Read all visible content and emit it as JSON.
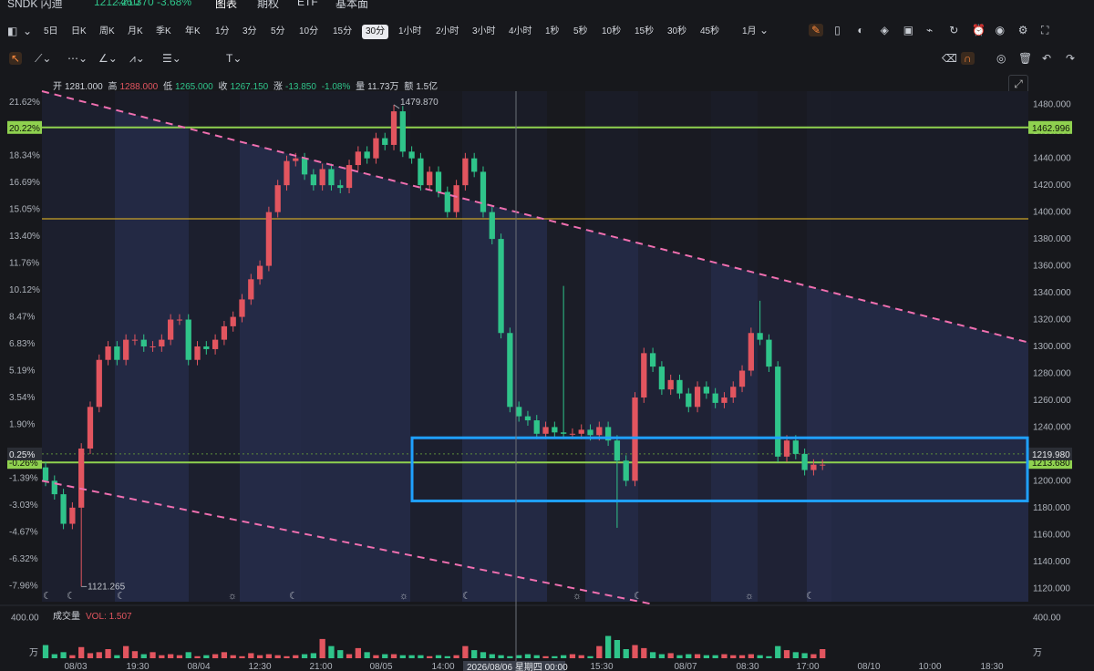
{
  "header": {
    "symbol": "SNDK 闪迪",
    "price": "1212.210",
    "change": "-46.370",
    "change_pct": "-3.68%",
    "tabs": [
      "图表",
      "期权",
      "ETF",
      "基本面"
    ]
  },
  "toolbar": {
    "periods": [
      "5日",
      "日K",
      "周K",
      "月K",
      "季K",
      "年K",
      "1分",
      "3分",
      "5分",
      "10分",
      "15分",
      "30分",
      "1小时",
      "2小时",
      "3小时",
      "4小时",
      "1秒",
      "5秒",
      "10秒",
      "15秒",
      "30秒",
      "45秒"
    ],
    "active_period": "30分",
    "range_label": "1月",
    "right_icons": [
      "pen-icon",
      "candle-icon",
      "compare-icon",
      "layers-icon",
      "indicator-icon",
      "chart-icon",
      "replay-icon",
      "alert-icon",
      "camera-icon",
      "settings-icon",
      "fullscreen-icon"
    ],
    "draw_tools": [
      "cursor-icon",
      "line-tool-icon",
      "fib-tool-icon",
      "brush-icon",
      "pattern-tool-icon",
      "measure-tool-icon",
      "text-tool-icon"
    ],
    "draw_right_icons": [
      "eraser-icon",
      "magnet-icon",
      "eye-icon",
      "trash-icon",
      "undo-icon",
      "redo-icon"
    ]
  },
  "ohlc": {
    "open_label": "开",
    "open": "1281.000",
    "high_label": "高",
    "high": "1288.000",
    "low_label": "低",
    "low": "1265.000",
    "close_label": "收",
    "close": "1267.150",
    "chg_label": "涨",
    "chg": "-13.850",
    "chg_pct": "-1.08%",
    "vol_label": "量",
    "vol": "11.73万",
    "amt_label": "额",
    "amt": "1.5亿"
  },
  "chart_data": {
    "type": "candlestick",
    "title": "",
    "ylim": [
      1110,
      1490
    ],
    "y_ticks": [
      1120,
      1140,
      1160,
      1180,
      1200,
      1220,
      1240,
      1260,
      1280,
      1300,
      1320,
      1340,
      1360,
      1380,
      1400,
      1420,
      1440,
      1460,
      1480
    ],
    "y_tick_labels": [
      "1120.000",
      "1140.000",
      "1160.000",
      "1180.000",
      "1200.000",
      "1220.000",
      "1240.000",
      "1260.000",
      "1280.000",
      "1300.000",
      "1320.000",
      "1340.000",
      "1360.000",
      "1380.000",
      "1400.000",
      "1420.000",
      "1440.000",
      "1460.000",
      "1480.000"
    ],
    "pct_ticks": [
      "21.62%",
      "18.34%",
      "16.69%",
      "15.05%",
      "13.40%",
      "11.76%",
      "10.12%",
      "8.47%",
      "6.83%",
      "5.19%",
      "3.54%",
      "1.90%",
      "0.25%",
      "-0.26%",
      "-1.39%",
      "-3.03%",
      "-4.67%",
      "-6.32%",
      "-7.96%"
    ],
    "pct_tick_values": [
      1482,
      1442,
      1422,
      1402,
      1382,
      1362,
      1342,
      1322,
      1302,
      1282,
      1262,
      1242,
      1222,
      1216,
      1202,
      1182,
      1162,
      1142,
      1122
    ],
    "x_tick_labels": [
      "08/03",
      "19:30",
      "08/04",
      "12:30",
      "21:00",
      "08/05",
      "14:00",
      "15:30",
      "08/07",
      "08:30",
      "17:00",
      "08/10",
      "10:00",
      "18:30"
    ],
    "crosshair_label": "2026/08/06 星期四 00:00",
    "price_levels": [
      {
        "value": 1462.996,
        "label": "1462.996",
        "pct": "20.22%",
        "color": "#8fd14f"
      },
      {
        "value": 1213.68,
        "label": "1213.680",
        "pct": "-0.26%",
        "color": "#8fd14f"
      },
      {
        "value": 1395,
        "label": "",
        "pct": "",
        "color": "#c9a227"
      }
    ],
    "last_price": {
      "value": 1219.98,
      "label": "1219.980",
      "pct": "0.25%"
    },
    "annotations": [
      {
        "text": "1479.870",
        "value": 1479.87
      },
      {
        "text": "1121.265",
        "value": 1121.265
      }
    ],
    "trendlines": [
      {
        "name": "upper",
        "from": [
          0,
          1490
        ],
        "to": [
          1,
          1303
        ]
      },
      {
        "name": "lower",
        "from": [
          0,
          1200
        ],
        "to": [
          0.62,
          1108
        ]
      }
    ],
    "highlight_box": {
      "y_top": 1232,
      "y_bottom": 1185,
      "color": "#1fa0ff"
    },
    "path_close": [
      1200,
      1190,
      1168,
      1180,
      1224,
      1255,
      1290,
      1300,
      1290,
      1305,
      1305,
      1300,
      1300,
      1305,
      1320,
      1320,
      1290,
      1300,
      1298,
      1305,
      1315,
      1322,
      1335,
      1350,
      1360,
      1400,
      1420,
      1438,
      1440,
      1428,
      1420,
      1432,
      1420,
      1418,
      1435,
      1445,
      1440,
      1455,
      1450,
      1475,
      1445,
      1440,
      1420,
      1430,
      1415,
      1400,
      1420,
      1440,
      1430,
      1400,
      1380,
      1310,
      1255,
      1248,
      1245,
      1235,
      1240,
      1236,
      1235,
      1235,
      1238,
      1234,
      1240,
      1230,
      1215,
      1200,
      1262,
      1295,
      1285,
      1268,
      1275,
      1265,
      1255,
      1270,
      1265,
      1258,
      1262,
      1270,
      1282,
      1310,
      1305,
      1285,
      1218,
      1230,
      1220,
      1208,
      1212,
      1212
    ],
    "volume": {
      "label": "成交量",
      "indicator": "VOL",
      "value": "1.507",
      "ylim": [
        0,
        450
      ],
      "y_tick": "400.00",
      "unit": "万",
      "values": [
        130,
        40,
        60,
        30,
        110,
        50,
        60,
        90,
        30,
        120,
        70,
        40,
        60,
        30,
        40,
        30,
        60,
        20,
        30,
        40,
        60,
        30,
        20,
        50,
        30,
        40,
        30,
        20,
        30,
        40,
        50,
        190,
        120,
        80,
        40,
        100,
        60,
        30,
        40,
        40,
        30,
        30,
        30,
        20,
        30,
        20,
        30,
        120,
        80,
        60,
        40,
        30,
        20,
        30,
        40,
        30,
        20,
        20,
        30,
        40,
        30,
        20,
        120,
        220,
        180,
        90,
        130,
        100,
        60,
        40,
        50,
        30,
        40,
        40,
        30,
        30,
        40,
        30,
        30,
        40,
        30,
        20,
        120,
        80,
        60,
        50,
        40,
        90
      ]
    }
  }
}
